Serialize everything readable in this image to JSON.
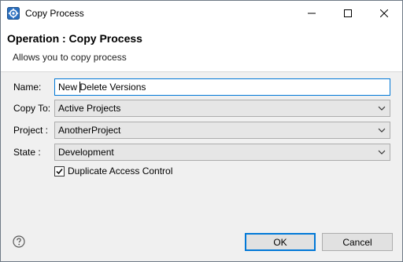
{
  "window": {
    "title": "Copy Process",
    "icon": "process-app-icon"
  },
  "header": {
    "title": "Operation : Copy Process",
    "description": "Allows you to copy process"
  },
  "form": {
    "name": {
      "label": "Name:",
      "value_before_cursor": "New ",
      "value_after_cursor": "Delete Versions"
    },
    "copy_to": {
      "label": "Copy To:",
      "selected": "Active Projects"
    },
    "project": {
      "label": "Project :",
      "selected": "AnotherProject"
    },
    "state": {
      "label": "State :",
      "selected": "Development"
    },
    "duplicate_access_control": {
      "label": "Duplicate Access Control",
      "checked": true
    }
  },
  "footer": {
    "help_icon": "help-icon",
    "ok_label": "OK",
    "cancel_label": "Cancel"
  },
  "colors": {
    "focus_border": "#0078d7",
    "dialog_bg": "#f0f0f0",
    "header_bg": "#ffffff"
  }
}
